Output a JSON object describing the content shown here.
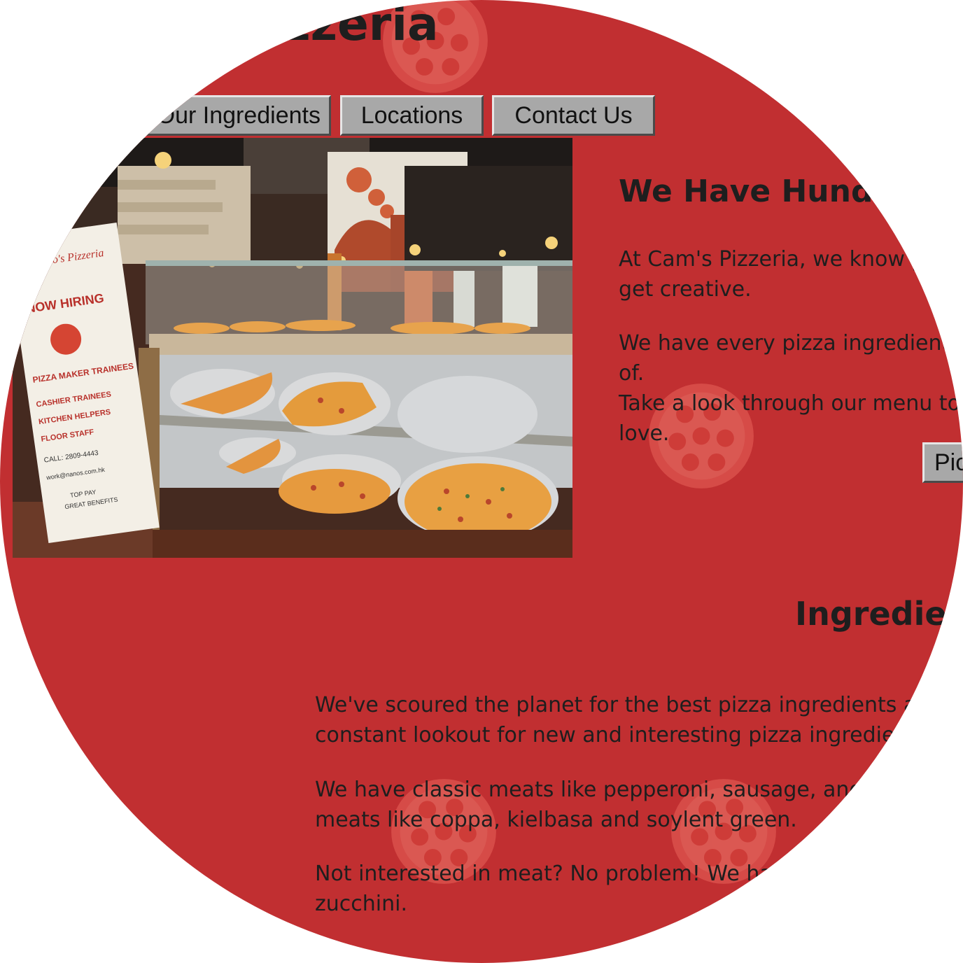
{
  "header": {
    "site_title": "Cam's Pizzeria"
  },
  "nav": {
    "ingredients_label": "Our Ingredients",
    "locations_label": "Locations",
    "contact_label": "Contact Us"
  },
  "hero_image": {
    "sign_brand": "Nano's Pizzeria",
    "sign_hiring": "NOW HIRING",
    "sign_lines": [
      "PIZZA MAKER TRAINEES",
      "CASHIER TRAINEES",
      "KITCHEN HELPERS",
      "FLOOR STAFF",
      "CALL: 2809-4443",
      "work@nanos.com.hk",
      "TOP PAY",
      "GREAT BENEFITS"
    ]
  },
  "section_intro": {
    "heading": "We Have Hundreds of Flavors",
    "paragraph_1": "At Cam's Pizzeria, we know pizza lovers like to\nget creative.",
    "paragraph_2": "We have every pizza ingredient you can think of.\nTake a look through our menu to find one you\nlove.",
    "button_label": "Pick"
  },
  "section_ingredients": {
    "heading": "Ingredients",
    "paragraph_1": "We've scoured the planet for the best pizza ingredients and we're on the\nconstant lookout for new and interesting pizza ingredients.",
    "paragraph_2": "We have classic meats like pepperoni, sausage, and ham plus specialty\nmeats like coppa, kielbasa and soylent green.",
    "paragraph_3": "Not interested in meat? No problem! We have olives, peppers, and\nzucchini."
  },
  "colors": {
    "background": "#c12f31",
    "text": "#1e1e1e",
    "button_face": "#a8a8a8",
    "pizza_decoration": "#e8625a"
  }
}
